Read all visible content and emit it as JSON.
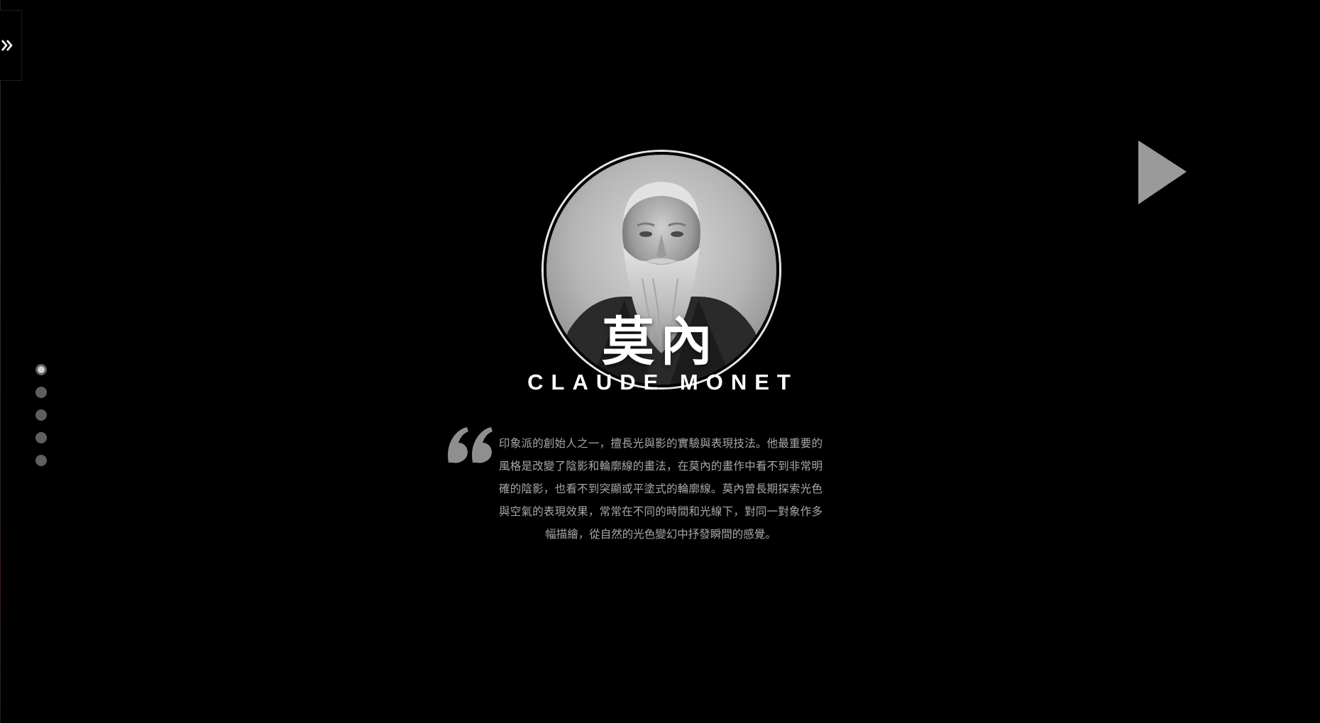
{
  "sidebar": {
    "toggle_icon": "double-chevron-right-icon"
  },
  "pagination": {
    "total": 5,
    "active_index": 0
  },
  "navigation": {
    "next_icon": "play-triangle-icon"
  },
  "artist": {
    "portrait_alt": "Claude Monet portrait",
    "name_cn": "莫內",
    "name_en": "CLAUDE MONET",
    "quote_icon": "quote-mark-icon",
    "description": "印象派的創始人之一，擅長光與影的實驗與表現技法。他最重要的風格是改變了陰影和輪廓線的畫法，在莫內的畫作中看不到非常明確的陰影，也看不到突顯或平塗式的輪廓線。莫內曾長期探索光色與空氣的表現效果，常常在不同的時間和光線下，對同一對象作多幅描繪，從自然的光色變幻中抒發瞬間的感覺。"
  },
  "colors": {
    "background": "#000000",
    "text_primary": "#ffffff",
    "text_secondary": "#a8a8a8",
    "quote_mark": "#8f8f8f",
    "next_arrow": "#999999",
    "dot_inactive": "#5f5f5f",
    "dot_active": "#cfcfcf"
  }
}
